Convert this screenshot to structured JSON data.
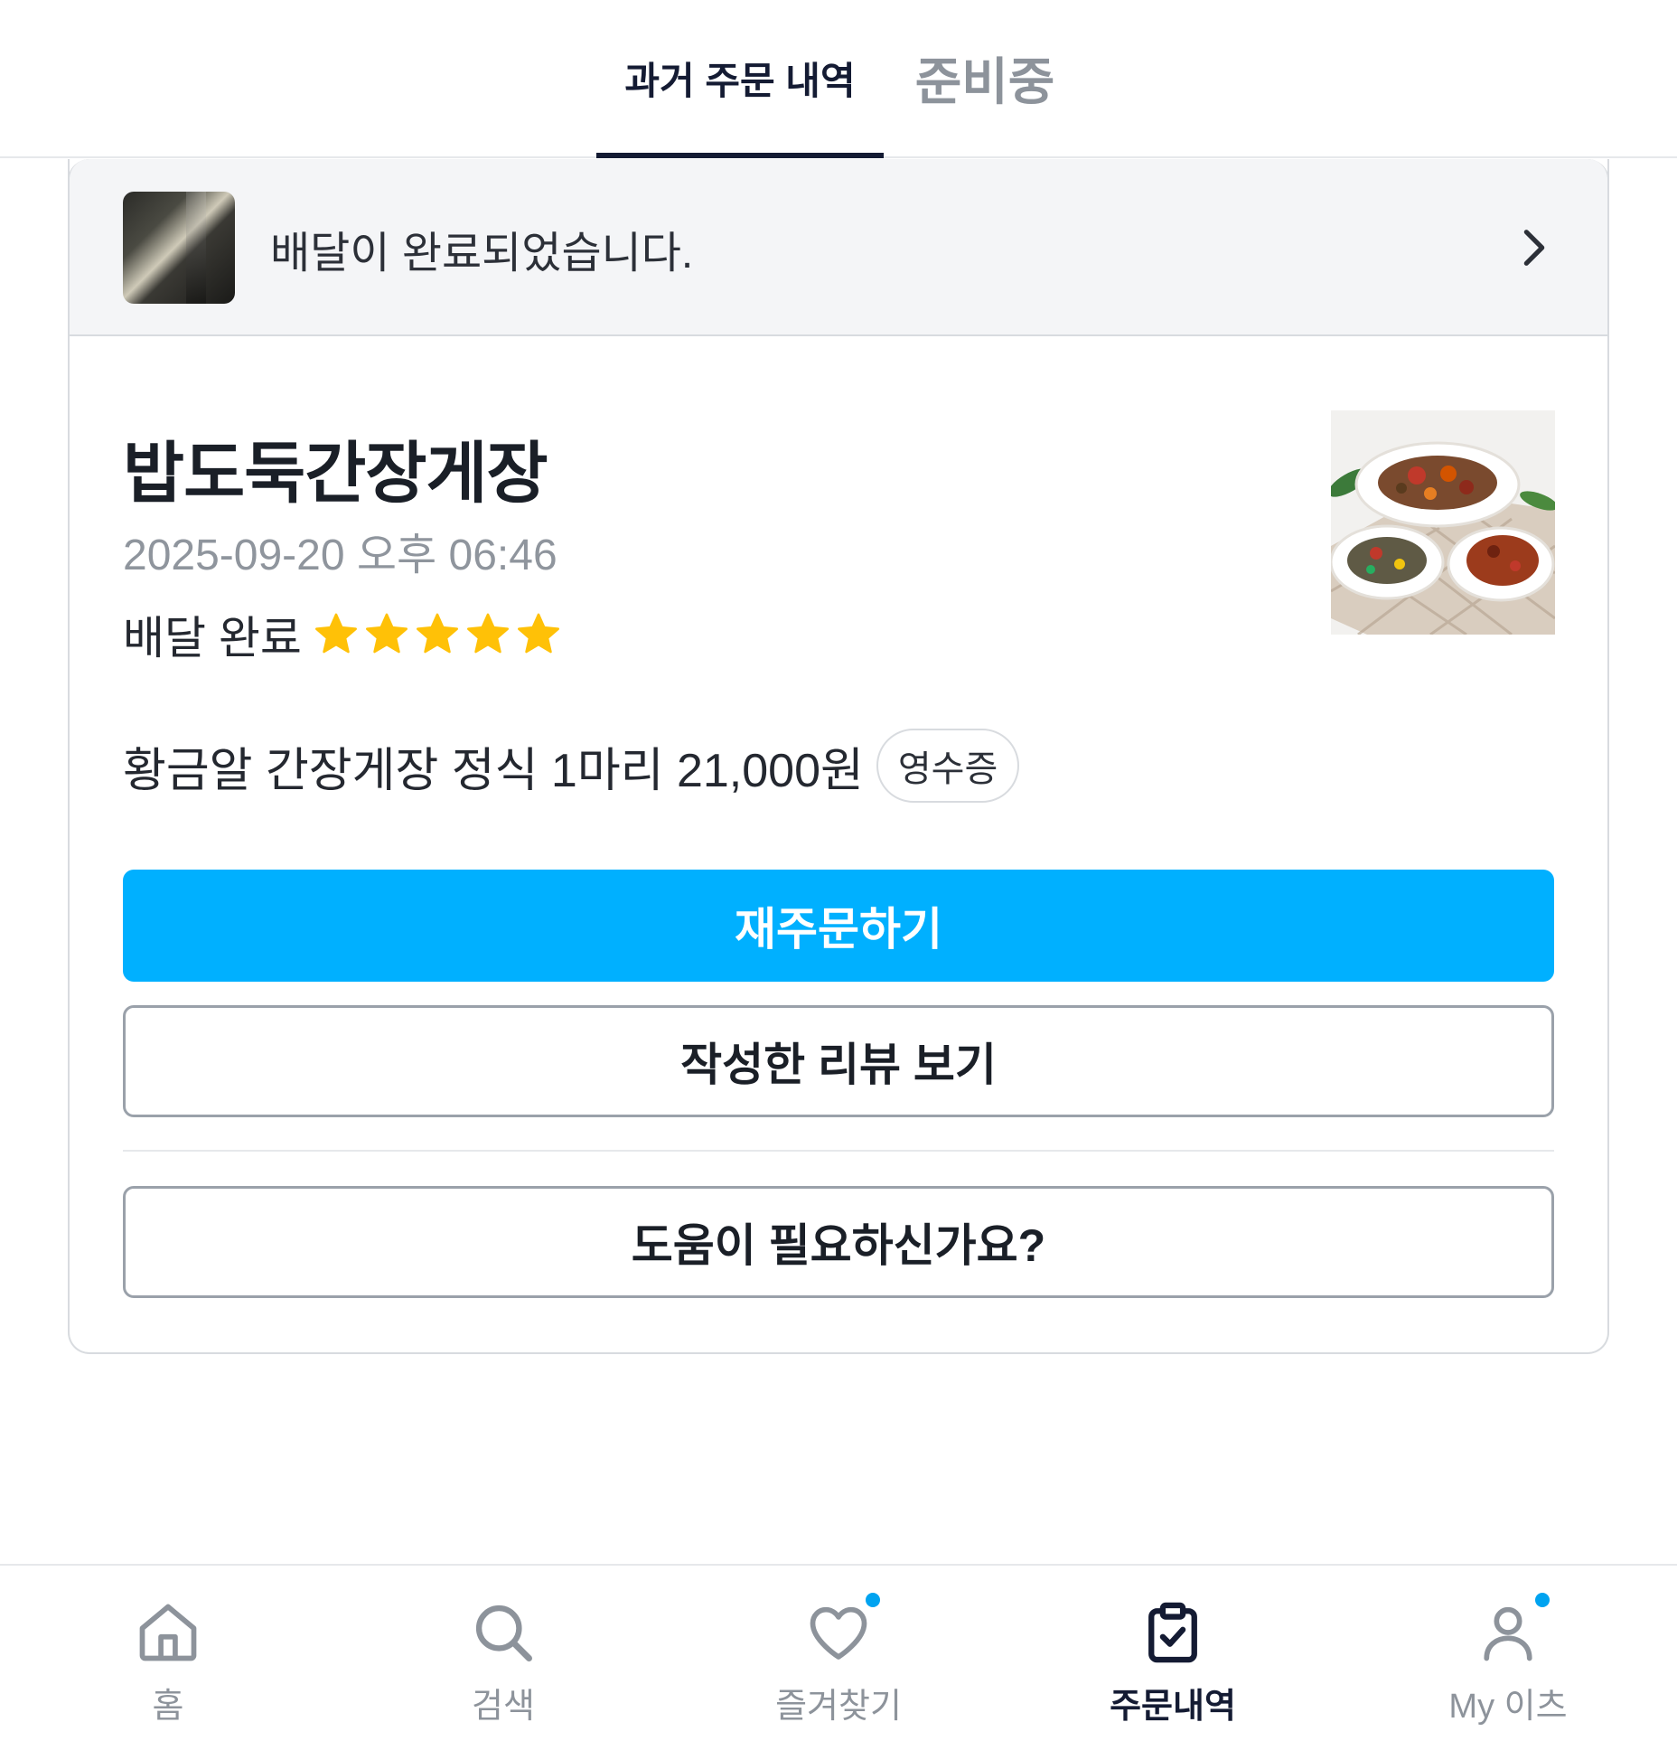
{
  "tabs": {
    "past_orders": "과거 주문 내역",
    "preparing": "준비중"
  },
  "order": {
    "status_banner": "배달이 완료되었습니다.",
    "restaurant_name": "밥도둑간장게장",
    "datetime": "2025-09-20 오후 06:46",
    "status": "배달 완료",
    "rating": 5,
    "menu_summary": "황금알 간장게장 정식 1마리 21,000원",
    "receipt_label": "영수증",
    "reorder_label": "재주문하기",
    "view_review_label": "작성한 리뷰 보기",
    "help_label": "도움이 필요하신가요?"
  },
  "bottom_nav": {
    "home": "홈",
    "search": "검색",
    "favorites": "즐겨찾기",
    "orders": "주문내역",
    "my": "My 이츠"
  },
  "colors": {
    "accent": "#00b0ff",
    "active_tab": "#141b33",
    "star": "#ffc107",
    "notification_dot": "#00a3f0"
  },
  "icons": {
    "chevron": "chevron-right-icon",
    "star": "star-icon",
    "home": "home-icon",
    "search": "search-icon",
    "favorites": "heart-icon",
    "orders": "clipboard-check-icon",
    "my": "user-icon"
  }
}
